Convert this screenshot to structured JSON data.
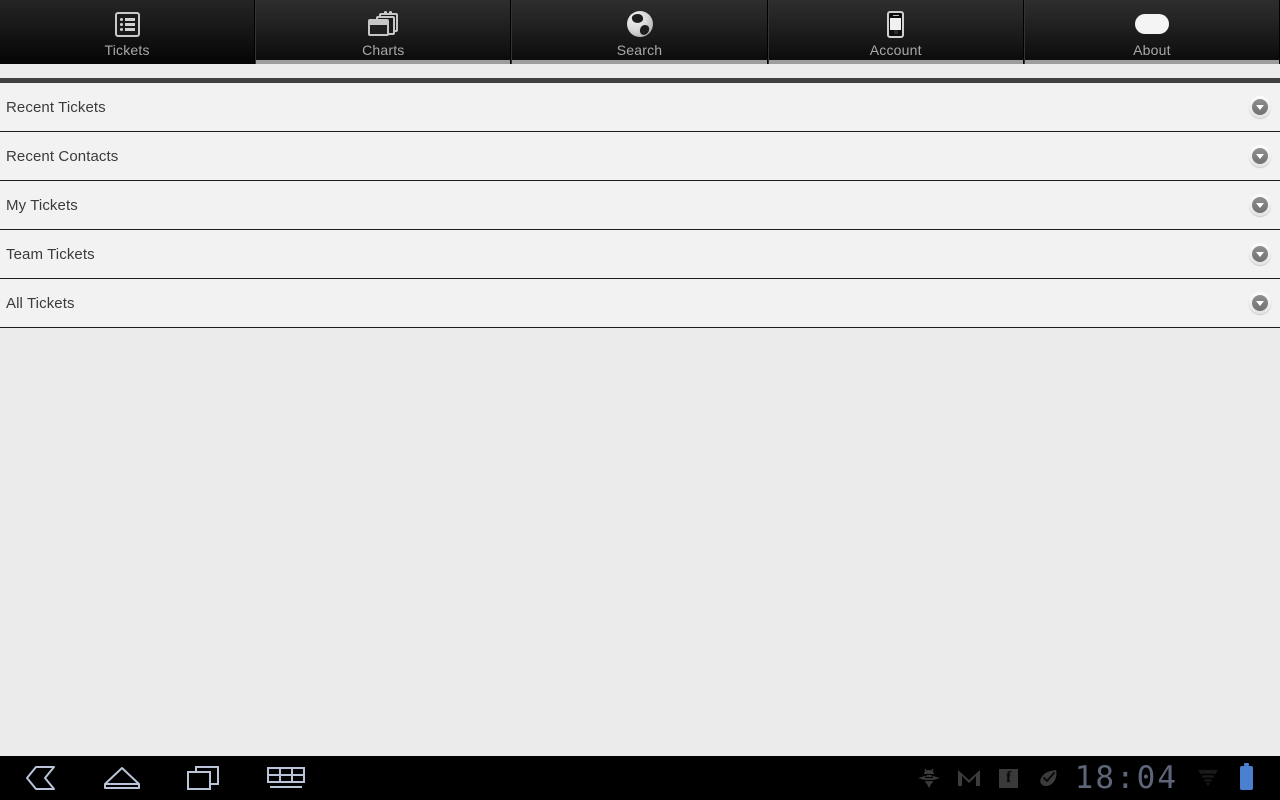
{
  "app": {
    "title": "Tickets"
  },
  "tabs": [
    {
      "label": "Tickets",
      "icon": "list-icon",
      "selected": true
    },
    {
      "label": "Charts",
      "icon": "stacked-windows-icon",
      "selected": false
    },
    {
      "label": "Search",
      "icon": "globe-icon",
      "selected": false
    },
    {
      "label": "Account",
      "icon": "phone-icon",
      "selected": false
    },
    {
      "label": "About",
      "icon": "pill-icon",
      "selected": false
    }
  ],
  "list": {
    "rows": [
      {
        "label": "Recent Tickets",
        "accessory": "chevron-down-icon"
      },
      {
        "label": "Recent Contacts",
        "accessory": "chevron-down-icon"
      },
      {
        "label": "My Tickets",
        "accessory": "chevron-down-icon"
      },
      {
        "label": "Team Tickets",
        "accessory": "chevron-down-icon"
      },
      {
        "label": "All Tickets",
        "accessory": "chevron-down-icon"
      }
    ]
  },
  "system_bar": {
    "nav": [
      {
        "name": "back-icon"
      },
      {
        "name": "home-icon"
      },
      {
        "name": "recent-apps-icon"
      },
      {
        "name": "keyboard-icon"
      }
    ],
    "notifications": [
      {
        "name": "bee-icon"
      },
      {
        "name": "gmail-icon"
      },
      {
        "name": "facebook-icon",
        "glyph": "f"
      },
      {
        "name": "leaf-check-icon"
      }
    ],
    "clock": "18:04",
    "status": [
      {
        "name": "wifi-icon"
      },
      {
        "name": "battery-icon"
      }
    ]
  },
  "colors": {
    "tab_bar_bg": "#151515",
    "tab_label": "#a8a8a8",
    "tab_underline": "#9d9d9d",
    "rule": "#414141",
    "row_bg": "#f2f2f2",
    "row_divider": "#1c1c1c",
    "row_text": "#3b3b3b",
    "empty_bg": "#ebebeb",
    "sysbar_bg": "#000000",
    "clock_text": "#5d6678",
    "battery": "#4b7fd0",
    "nav_icon": "#b9c4d8"
  }
}
